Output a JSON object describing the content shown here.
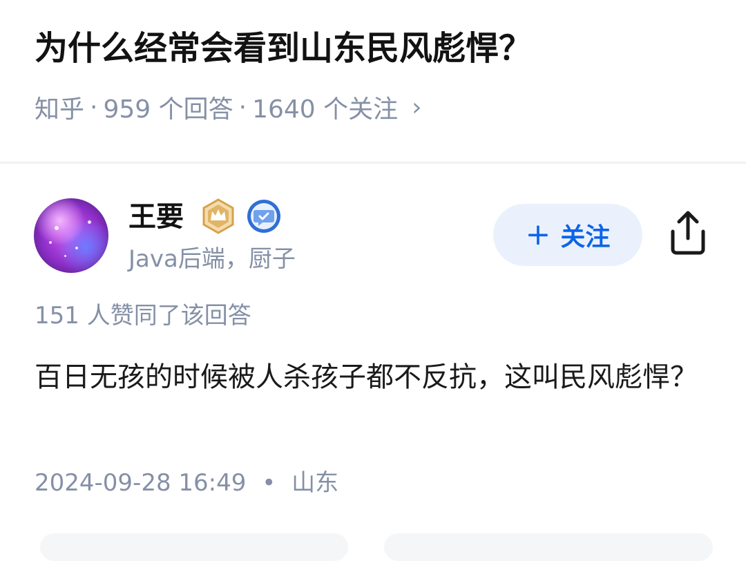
{
  "question": {
    "title": "为什么经常会看到山东民风彪悍？",
    "source": "知乎",
    "answers_count": "959 个回答",
    "followers_count": "1640 个关注",
    "separator": "·",
    "chevron": "›"
  },
  "author": {
    "name": "王要",
    "bio": "Java后端，厨子",
    "badges": [
      "crown-badge-icon",
      "verified-chat-badge-icon"
    ],
    "accent_gold": "#d6a24a",
    "accent_blue": "#3b7be8"
  },
  "follow_button": {
    "plus": "+",
    "label": "关注",
    "color": "#0d64e8",
    "background": "#ebf1fc"
  },
  "share_icon": "share-icon",
  "answer": {
    "votes": "151 人赞同了该回答",
    "text": "百日无孩的时候被人杀孩子都不反抗，这叫民风彪悍？",
    "date": "2024-09-28 16:49",
    "dot": "•",
    "location": "山东"
  }
}
